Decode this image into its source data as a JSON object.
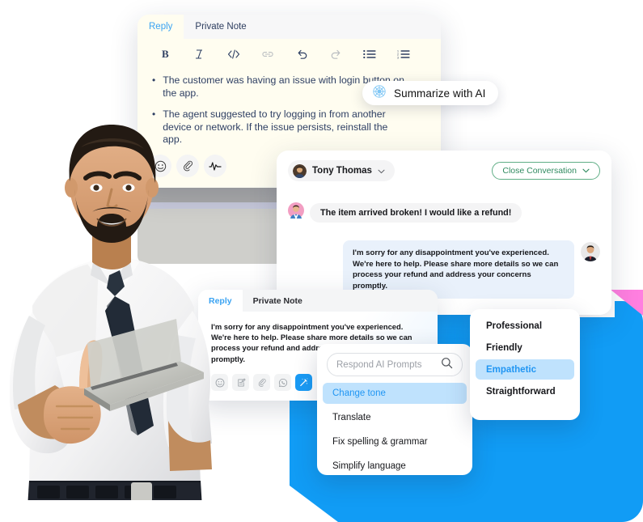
{
  "colors": {
    "accent_blue": "#119cf5",
    "accent_pink": "#ff7fe0",
    "tab_active_blue": "#3aa3f2",
    "editor_cream": "#fffdf0",
    "selection_blue": "#bfe2fd",
    "green_outline": "#5fae86"
  },
  "top_editor": {
    "tabs": [
      {
        "label": "Reply",
        "active": true
      },
      {
        "label": "Private Note",
        "active": false
      }
    ],
    "toolbar_icons": [
      "bold-icon",
      "italic-icon",
      "code-icon",
      "link-icon",
      "undo-icon",
      "redo-icon",
      "bullet-list-icon",
      "numbered-list-icon"
    ],
    "bullets": [
      "The customer was having an issue with login button on the app.",
      "The agent suggested to try logging in from another device or network. If the issue persists, reinstall the app."
    ],
    "bullet_marker": "•",
    "footer_icons": [
      "emoji-icon",
      "attachment-icon",
      "activity-icon"
    ]
  },
  "summarize": {
    "label": "Summarize with AI",
    "icon": "ai-brain-icon"
  },
  "conversation": {
    "user_name": "Tony Thomas",
    "user_chevron": "⌄",
    "close_button": "Close Conversation",
    "close_chevron": "⌄",
    "incoming_message": "The item arrived broken! I would like a refund!",
    "outgoing_message": "I'm sorry for any disappointment you've experienced. We're here to help. Please share more details so we can process your refund and address your concerns promptly."
  },
  "bottom_editor": {
    "tabs": [
      {
        "label": "Reply",
        "active": true
      },
      {
        "label": "Private Note",
        "active": false
      }
    ],
    "body_text": "I'm sorry for any disappointment you've experienced. We're here to help. Please share more details so we can process your refund and address your concerns promptly.",
    "footer_icons": [
      "emoji-icon",
      "note-icon",
      "attachment-icon",
      "whatsapp-icon",
      "magic-wand-icon"
    ]
  },
  "ai_prompts": {
    "placeholder": "Respond AI Prompts",
    "search_icon": "search-icon",
    "items": [
      {
        "label": "Change tone",
        "selected": true
      },
      {
        "label": "Translate",
        "selected": false
      },
      {
        "label": "Fix spelling & grammar",
        "selected": false
      },
      {
        "label": "Simplify language",
        "selected": false
      }
    ]
  },
  "tone_menu": {
    "items": [
      {
        "label": "Professional",
        "selected": false
      },
      {
        "label": "Friendly",
        "selected": false
      },
      {
        "label": "Empathetic",
        "selected": true
      },
      {
        "label": "Straightforward",
        "selected": false
      }
    ]
  }
}
